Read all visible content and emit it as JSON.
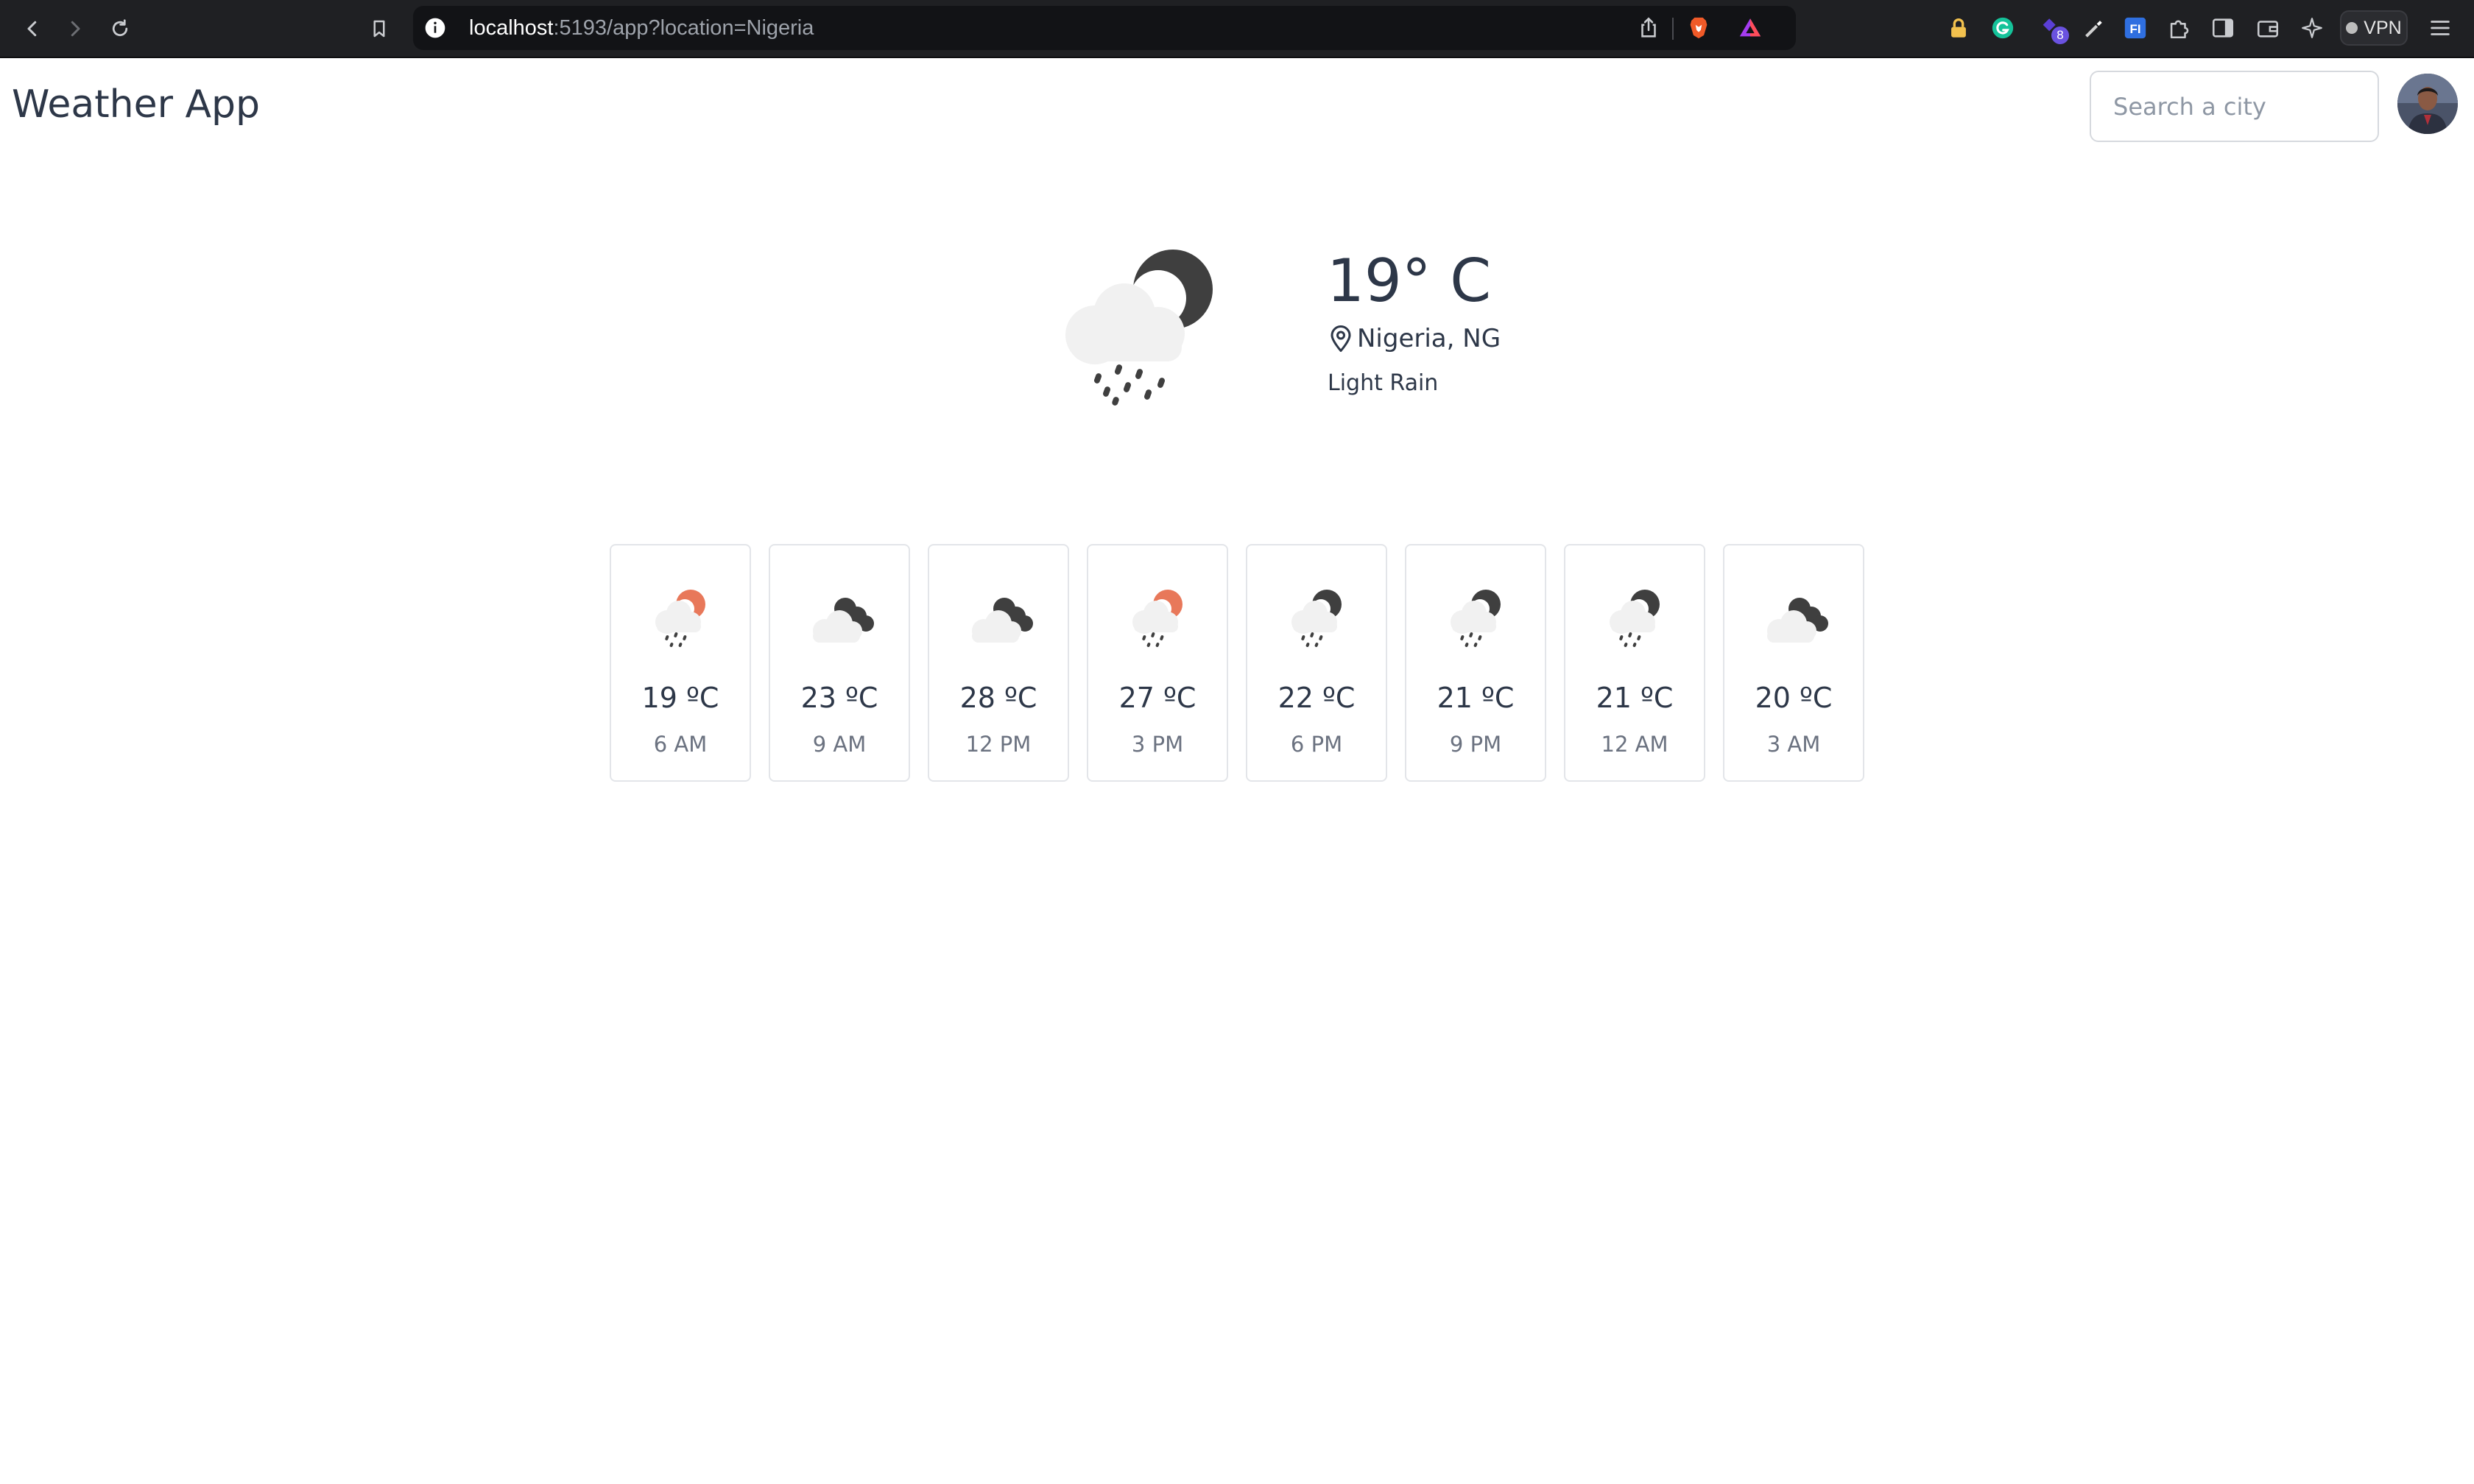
{
  "browser": {
    "url_host": "localhost",
    "url_rest": ":5193/app?location=Nigeria",
    "extension_badge": "8",
    "vpn_label": "VPN"
  },
  "app": {
    "title": "Weather App",
    "search_placeholder": "Search a city"
  },
  "current": {
    "temperature": "19° C",
    "location": "Nigeria, NG",
    "condition": "Light Rain",
    "icon": "light-rain-night-icon"
  },
  "forecast": [
    {
      "temp": "19 ºC",
      "time": "6 AM",
      "icon": "light-rain-day-icon"
    },
    {
      "temp": "23 ºC",
      "time": "9 AM",
      "icon": "overcast-clouds-icon"
    },
    {
      "temp": "28 ºC",
      "time": "12 PM",
      "icon": "overcast-clouds-icon"
    },
    {
      "temp": "27 ºC",
      "time": "3 PM",
      "icon": "light-rain-day-icon"
    },
    {
      "temp": "22 ºC",
      "time": "6 PM",
      "icon": "light-rain-night-icon"
    },
    {
      "temp": "21 ºC",
      "time": "9 PM",
      "icon": "light-rain-night-icon"
    },
    {
      "temp": "21 ºC",
      "time": "12 AM",
      "icon": "light-rain-night-icon"
    },
    {
      "temp": "20 ºC",
      "time": "3 AM",
      "icon": "overcast-clouds-icon"
    }
  ],
  "colors": {
    "text": "#2d3748",
    "muted": "#6b7280",
    "sun": "#e8785a",
    "moon": "#4a4a4a",
    "cloud": "#eeeeee"
  }
}
